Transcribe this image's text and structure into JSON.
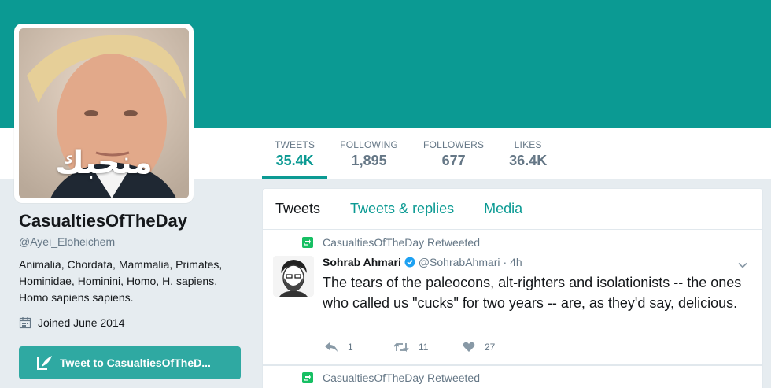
{
  "profile": {
    "avatar_text": "منحبك",
    "name": "CasualtiesOfTheDay",
    "handle": "@Ayei_Eloheichem",
    "bio": "Animalia, Chordata, Mammalia, Primates, Hominidae, Hominini, Homo, H. sapiens, Homo sapiens sapiens.",
    "joined": "Joined June 2014",
    "tweet_to_label": "Tweet to CasualtiesOfTheD..."
  },
  "stats": [
    {
      "label": "TWEETS",
      "value": "35.4K"
    },
    {
      "label": "FOLLOWING",
      "value": "1,895"
    },
    {
      "label": "FOLLOWERS",
      "value": "677"
    },
    {
      "label": "LIKES",
      "value": "36.4K"
    }
  ],
  "timeline": {
    "tabs": [
      "Tweets",
      "Tweets & replies",
      "Media"
    ],
    "tweets": [
      {
        "retweeted_by": "CasualtiesOfTheDay Retweeted",
        "author_name": "Sohrab Ahmari",
        "author_handle": "@SohrabAhmari",
        "time": "· 4h",
        "text": "The tears of the paleocons, alt-righters and isolationists -- the ones who called us \"cucks\" for two years -- are, as they'd say, delicious.",
        "replies": "1",
        "retweets": "11",
        "likes": "27"
      },
      {
        "retweeted_by": "CasualtiesOfTheDay Retweeted"
      }
    ]
  },
  "colors": {
    "accent": "#0b9a93",
    "button": "#2fa9a2",
    "retweet_green": "#17bf63",
    "verified_blue": "#1da1f2"
  }
}
